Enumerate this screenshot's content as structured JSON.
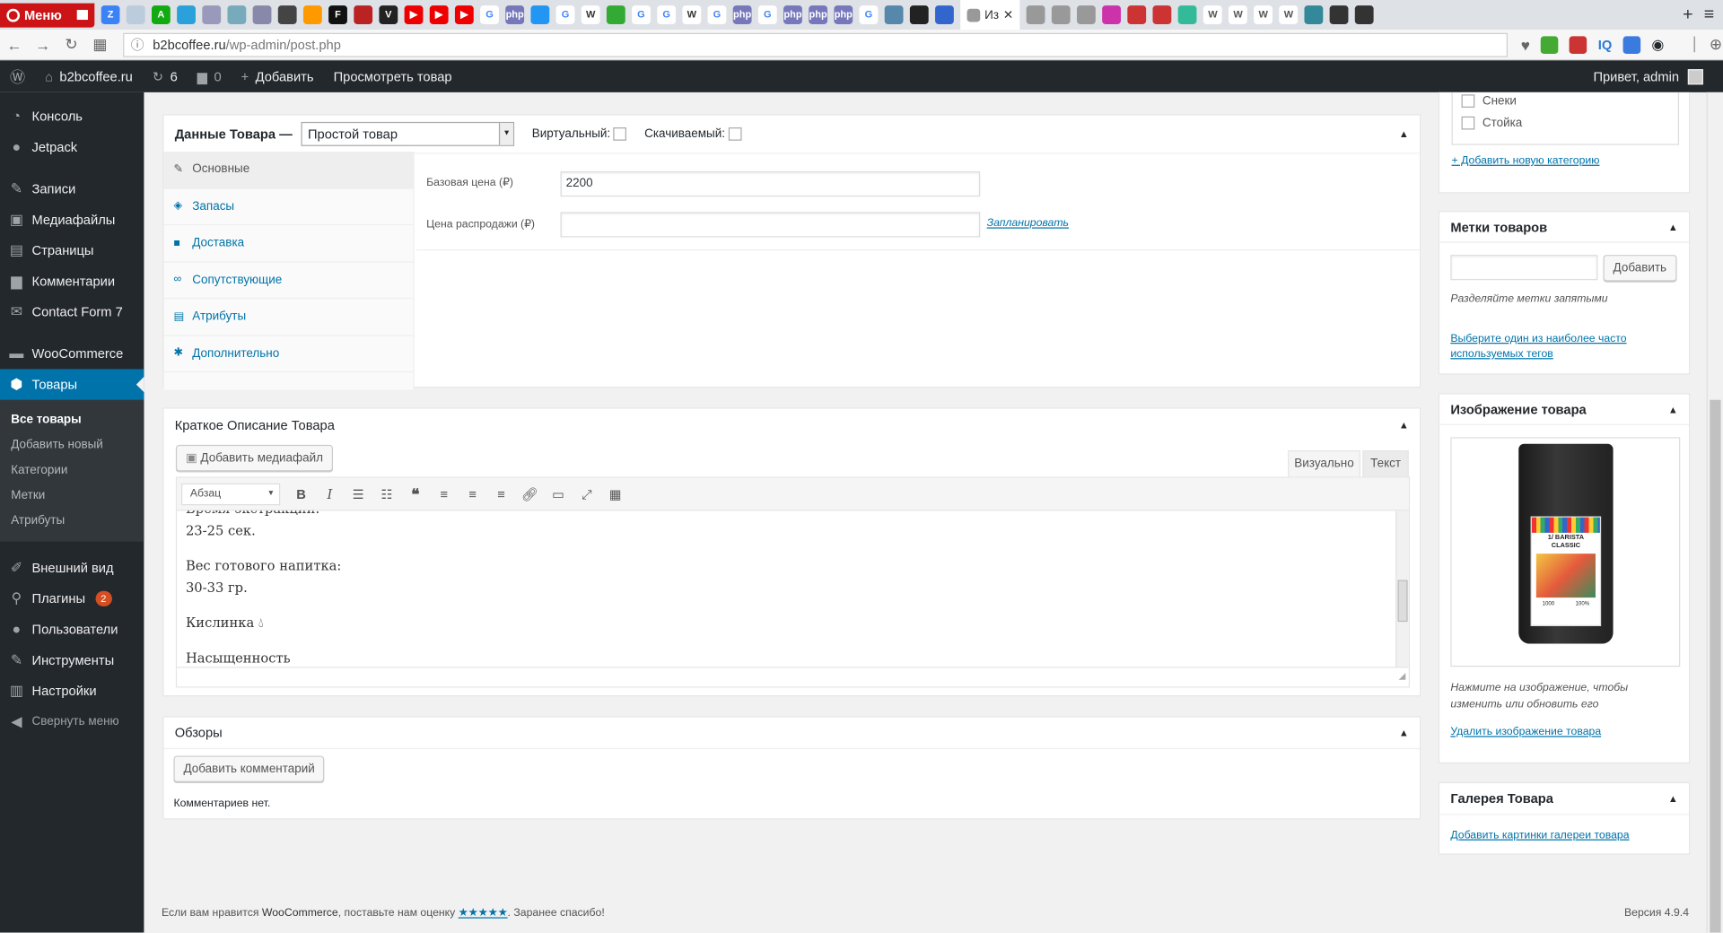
{
  "browser": {
    "menu_label": "Меню",
    "active_tab_title": "Из",
    "url_domain": "b2bcoffee.ru",
    "url_path": "/wp-admin/post.php",
    "icons": [
      "opera-icon",
      "star-icon",
      "download-icon",
      "iq-icon",
      "translate-icon",
      "eye-icon"
    ]
  },
  "adminbar": {
    "site": "b2bcoffee.ru",
    "updates_count": "6",
    "comments_count": "0",
    "add_label": "Добавить",
    "view_label": "Просмотреть товар",
    "greeting": "Привет, admin"
  },
  "sidebar": {
    "items": [
      {
        "label": "Консоль",
        "icon": "dashboard-icon"
      },
      {
        "label": "Jetpack",
        "icon": "jetpack-icon"
      },
      {
        "label": "Записи",
        "icon": "pin-icon"
      },
      {
        "label": "Медиафайлы",
        "icon": "media-icon"
      },
      {
        "label": "Страницы",
        "icon": "page-icon"
      },
      {
        "label": "Комментарии",
        "icon": "comment-icon"
      },
      {
        "label": "Contact Form 7",
        "icon": "mail-icon"
      },
      {
        "label": "WooCommerce",
        "icon": "woo-icon"
      },
      {
        "label": "Товары",
        "icon": "box-icon"
      },
      {
        "label": "Внешний вид",
        "icon": "brush-icon"
      },
      {
        "label": "Плагины",
        "icon": "plugin-icon",
        "badge": "2"
      },
      {
        "label": "Пользователи",
        "icon": "user-icon"
      },
      {
        "label": "Инструменты",
        "icon": "wrench-icon"
      },
      {
        "label": "Настройки",
        "icon": "settings-icon"
      },
      {
        "label": "Свернуть меню",
        "icon": "collapse-icon"
      }
    ],
    "submenu": [
      "Все товары",
      "Добавить новый",
      "Категории",
      "Метки",
      "Атрибуты"
    ]
  },
  "product_data": {
    "title": "Данные Товара —",
    "type_selected": "Простой товар",
    "virtual_label": "Виртуальный:",
    "downloadable_label": "Скачиваемый:",
    "tabs": [
      "Основные",
      "Запасы",
      "Доставка",
      "Сопутствующие",
      "Атрибуты",
      "Дополнительно"
    ],
    "regular_price_label": "Базовая цена (₽)",
    "regular_price_value": "2200",
    "sale_price_label": "Цена распродажи (₽)",
    "sale_price_value": "",
    "schedule_link": "Запланировать"
  },
  "short_description": {
    "title": "Краткое Описание Товара",
    "add_media": "Добавить медиафайл",
    "visual_tab": "Визуально",
    "text_tab": "Текст",
    "format_select": "Абзац",
    "content": [
      "Время экстракции:",
      "23-25 сек.",
      "Вес готового напитка:",
      "30-33 гр.",
      "Кислинка",
      "Насыщенность"
    ]
  },
  "reviews": {
    "title": "Обзоры",
    "add_comment": "Добавить комментарий",
    "no_comments": "Комментариев нет."
  },
  "categories": {
    "items": [
      "Снеки",
      "Стойка"
    ],
    "add_new_link": "+ Добавить новую категорию"
  },
  "tags": {
    "title": "Метки товаров",
    "add_button": "Добавить",
    "hint": "Разделяйте метки запятыми",
    "popular_link": "Выберите один из наиболее часто используемых тегов"
  },
  "product_image": {
    "title": "Изображение товара",
    "label_line1": "1/ BARISTA",
    "label_line2": "CLASSIC",
    "label_weight": "1000",
    "label_percent": "100%",
    "hint": "Нажмите на изображение, чтобы изменить или обновить его",
    "remove_link": "Удалить изображение товара"
  },
  "gallery": {
    "title": "Галерея Товара",
    "add_link": "Добавить картинки галереи товара"
  },
  "footer": {
    "text_before": "Если вам нравится ",
    "brand": "WooCommerce",
    "text_middle": ", поставьте нам оценку ",
    "stars": "★★★★★",
    "text_after": ". Заранее спасибо!",
    "version": "Версия 4.9.4"
  },
  "colors": {
    "accent": "#0073aa",
    "adminbar": "#23282d",
    "badge": "#d54e21",
    "opera": "#cc1417"
  }
}
